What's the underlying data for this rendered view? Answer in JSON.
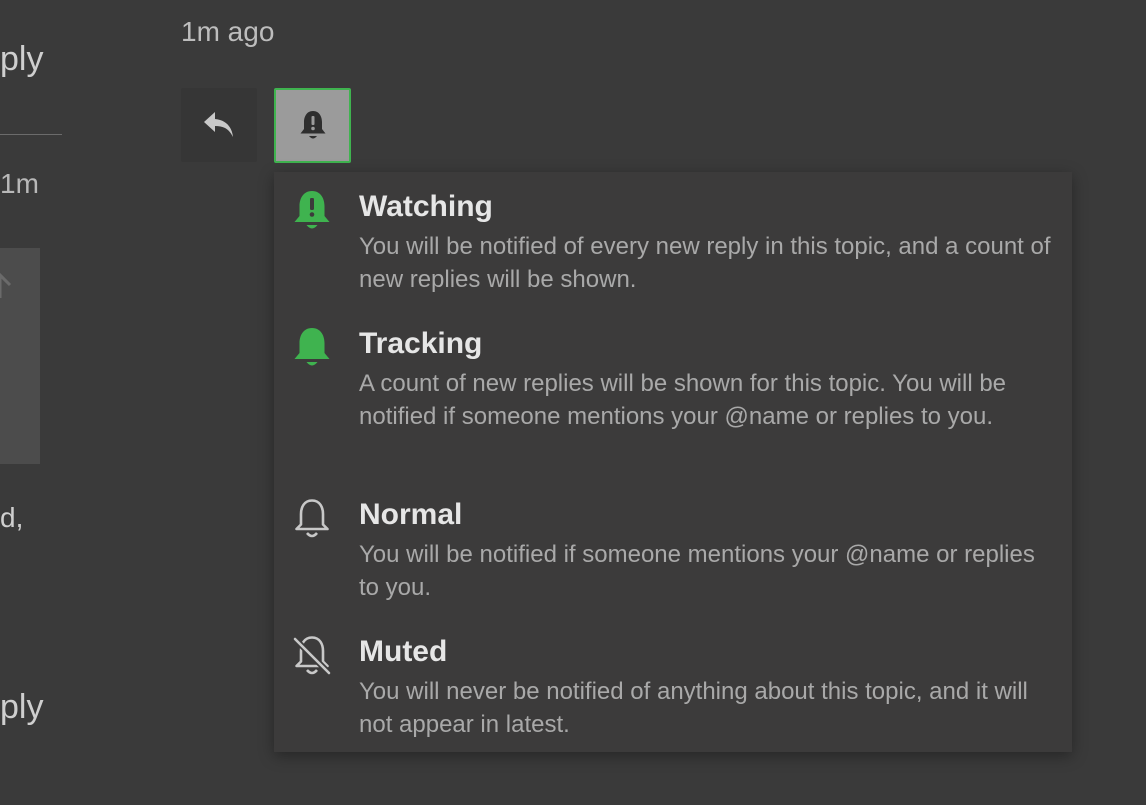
{
  "background_post": {
    "reply_top": "ply",
    "ago_fragment": "1m",
    "text_fragment": "d,",
    "reply_bottom": "ply"
  },
  "post": {
    "time": "1m ago"
  },
  "colors": {
    "accent_green": "#3fb34f",
    "background": "#3a3a3a",
    "menu_background": "#3c3b3b"
  },
  "notification_menu": {
    "items": [
      {
        "title": "Watching",
        "icon": "bell-exclamation-icon",
        "description": "You will be notified of every new reply in this topic, and a count of new replies will be shown."
      },
      {
        "title": "Tracking",
        "icon": "bell-filled-icon",
        "description": "A count of new replies will be shown for this topic. You will be notified if someone mentions your @name or replies to you."
      },
      {
        "title": "Normal",
        "icon": "bell-outline-icon",
        "description": "You will be notified if someone mentions your @name or replies to you."
      },
      {
        "title": "Muted",
        "icon": "bell-slash-icon",
        "description": "You will never be notified of anything about this topic, and it will not appear in latest."
      }
    ]
  }
}
